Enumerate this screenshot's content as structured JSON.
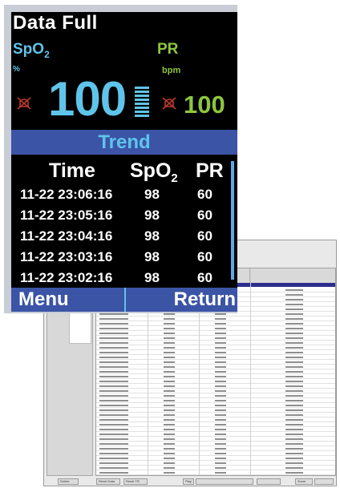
{
  "device": {
    "title": "Data Full",
    "spo2": {
      "label": "SpO",
      "label_sub": "2",
      "unit": "%",
      "value": "100"
    },
    "pr": {
      "label": "PR",
      "unit": "bpm",
      "value": "100"
    },
    "alarm_icon": "alarm-muted-icon",
    "trend_label": "Trend",
    "table": {
      "headers": {
        "time": "Time",
        "spo2": "SpO",
        "spo2_sub": "2",
        "pr": "PR"
      },
      "rows": [
        {
          "time": "11-22  23:06:16",
          "spo2": "98",
          "pr": "60"
        },
        {
          "time": "11-22  23:05:16",
          "spo2": "98",
          "pr": "60"
        },
        {
          "time": "11-22  23:04:16",
          "spo2": "98",
          "pr": "60"
        },
        {
          "time": "11-22  23:03:16",
          "spo2": "98",
          "pr": "60"
        },
        {
          "time": "11-22  23:02:16",
          "spo2": "98",
          "pr": "60"
        }
      ]
    },
    "menu_label": "Menu",
    "return_label": "Return",
    "colors": {
      "spo2": "#5fc4ea",
      "pr": "#8dc63f",
      "bar": "#3b54a6",
      "screen": "#000000"
    }
  },
  "pc_software": {
    "status_bar": [
      "Delete",
      "Reset Data",
      "Reset TR",
      "Play",
      "Zoom"
    ]
  }
}
